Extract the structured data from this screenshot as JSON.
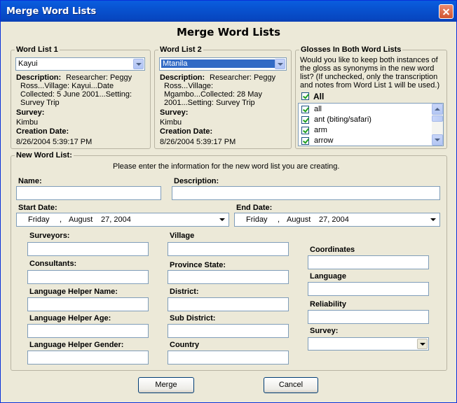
{
  "window": {
    "title": "Merge Word Lists"
  },
  "heading": "Merge Word Lists",
  "word_list_1": {
    "legend": "Word List 1",
    "selected": "Kayui",
    "description_label": "Description:",
    "description_l1": "Researcher: Peggy",
    "description_l2": "Ross...Village: Kayui...Date",
    "description_l3": "Collected: 5 June 2001...Setting:",
    "description_l4": "Survey Trip",
    "survey_label": "Survey:",
    "survey_value": "Kimbu",
    "creation_label": "Creation Date:",
    "creation_value": "8/26/2004 5:39:17 PM"
  },
  "word_list_2": {
    "legend": "Word List 2",
    "selected": "Mtanila",
    "description_label": "Description:",
    "description_l1": "Researcher: Peggy",
    "description_l2": "Ross...Village:",
    "description_l3": "Mgambo...Collected: 28 May",
    "description_l4": "2001...Setting: Survey Trip",
    "survey_label": "Survey:",
    "survey_value": "Kimbu",
    "creation_label": "Creation Date:",
    "creation_value": "8/26/2004 5:39:17 PM"
  },
  "glosses": {
    "legend": "Glosses In Both Word Lists",
    "question_l1": "Would you like to keep both instances of",
    "question_l2": "the gloss as synonyms in the new word",
    "question_l3": "list?  (If unchecked, only the transcription",
    "question_l4": "and notes from Word List 1 will be used.)",
    "all_label": "All",
    "all_checked": true,
    "items": [
      {
        "label": "all",
        "checked": true
      },
      {
        "label": "ant (biting/safari)",
        "checked": true
      },
      {
        "label": "arm",
        "checked": true
      },
      {
        "label": "arrow",
        "checked": true
      }
    ]
  },
  "new_list": {
    "legend": "New Word List:",
    "instruction": "Please enter the information for the new word list you are creating.",
    "name_label": "Name:",
    "name_value": "",
    "description_label": "Description:",
    "description_value": "",
    "start_label": "Start Date:",
    "start_day": "Friday",
    "start_month": "August",
    "start_date": "27, 2004",
    "end_label": "End Date:",
    "end_day": "Friday",
    "end_month": "August",
    "end_date": "27, 2004",
    "date_sep": ",",
    "col1": [
      "Surveyors:",
      "Consultants:",
      "Language Helper Name:",
      "Language Helper Age:",
      "Language Helper Gender:"
    ],
    "col2": [
      "Village",
      "Province State:",
      "District:",
      "Sub District:",
      "Country"
    ],
    "col3": [
      "Coordinates",
      "Language",
      "Reliability",
      "Survey:"
    ]
  },
  "buttons": {
    "merge": "Merge",
    "cancel": "Cancel"
  }
}
